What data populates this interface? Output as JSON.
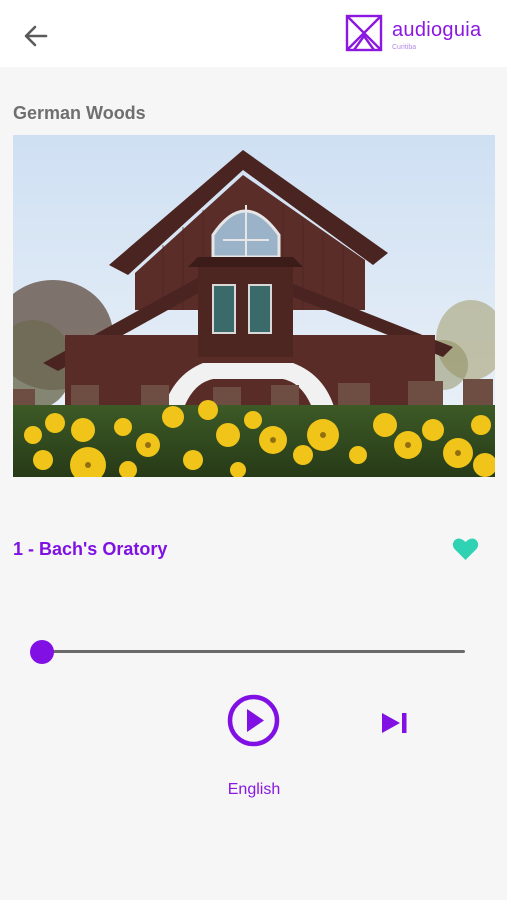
{
  "header": {
    "back_icon": "arrow-left-icon",
    "logo_name": "audioguia",
    "logo_sub": "Curitiba",
    "brand_color": "#8a18e0"
  },
  "place": {
    "title": "German Woods",
    "photo_subject": "wooden chapel behind yellow pansies"
  },
  "player": {
    "track_title": "1 - Bach's Oratory",
    "favorite_icon": "heart-icon",
    "favorite_color": "#2fd3b4",
    "progress": 0,
    "play_icon": "play-circle-icon",
    "next_icon": "skip-next-icon",
    "language": "English",
    "accent_color": "#8110e4"
  }
}
